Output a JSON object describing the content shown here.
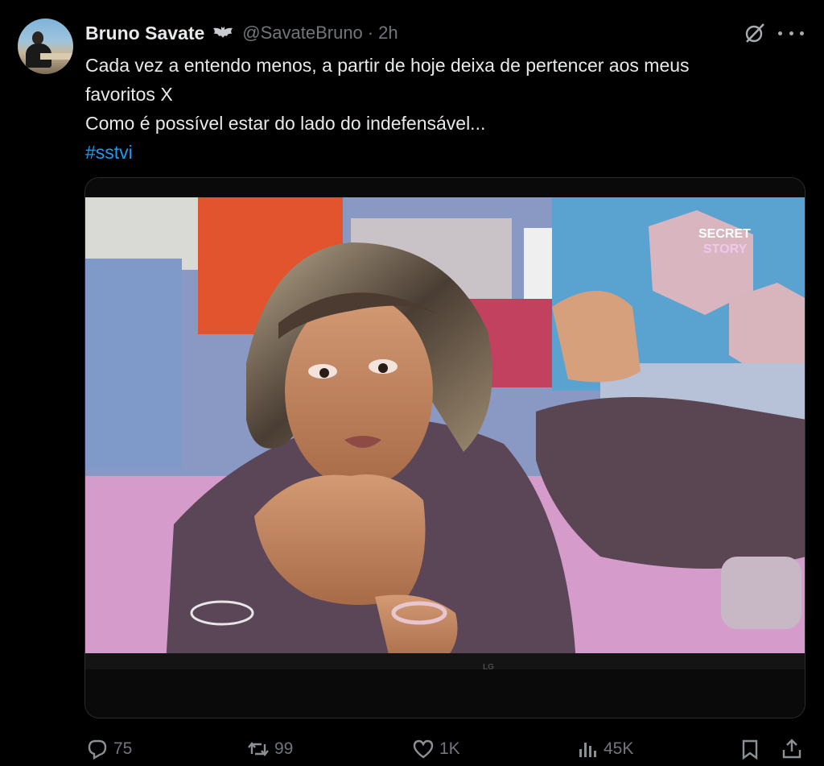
{
  "author": {
    "display_name": "Bruno Savate",
    "affiliation_icon": "bat-icon",
    "handle": "@SavateBruno",
    "separator": "·",
    "time": "2h"
  },
  "post": {
    "lines": [
      "Cada vez a entendo menos, a partir de hoje deixa de pertencer aos meus",
      "favoritos X",
      "Como é possível estar do lado do indefensável..."
    ],
    "hashtag": "#sstvi"
  },
  "media": {
    "show_logo_line1": "SECRET",
    "show_logo_line2": "STORY",
    "tv_brand": "LG"
  },
  "actions": {
    "replies": "75",
    "reposts": "99",
    "likes": "1K",
    "views": "45K"
  },
  "colors": {
    "background": "#000000",
    "text": "#e7e9ea",
    "muted": "#71767b",
    "link": "#1d9bf0"
  }
}
